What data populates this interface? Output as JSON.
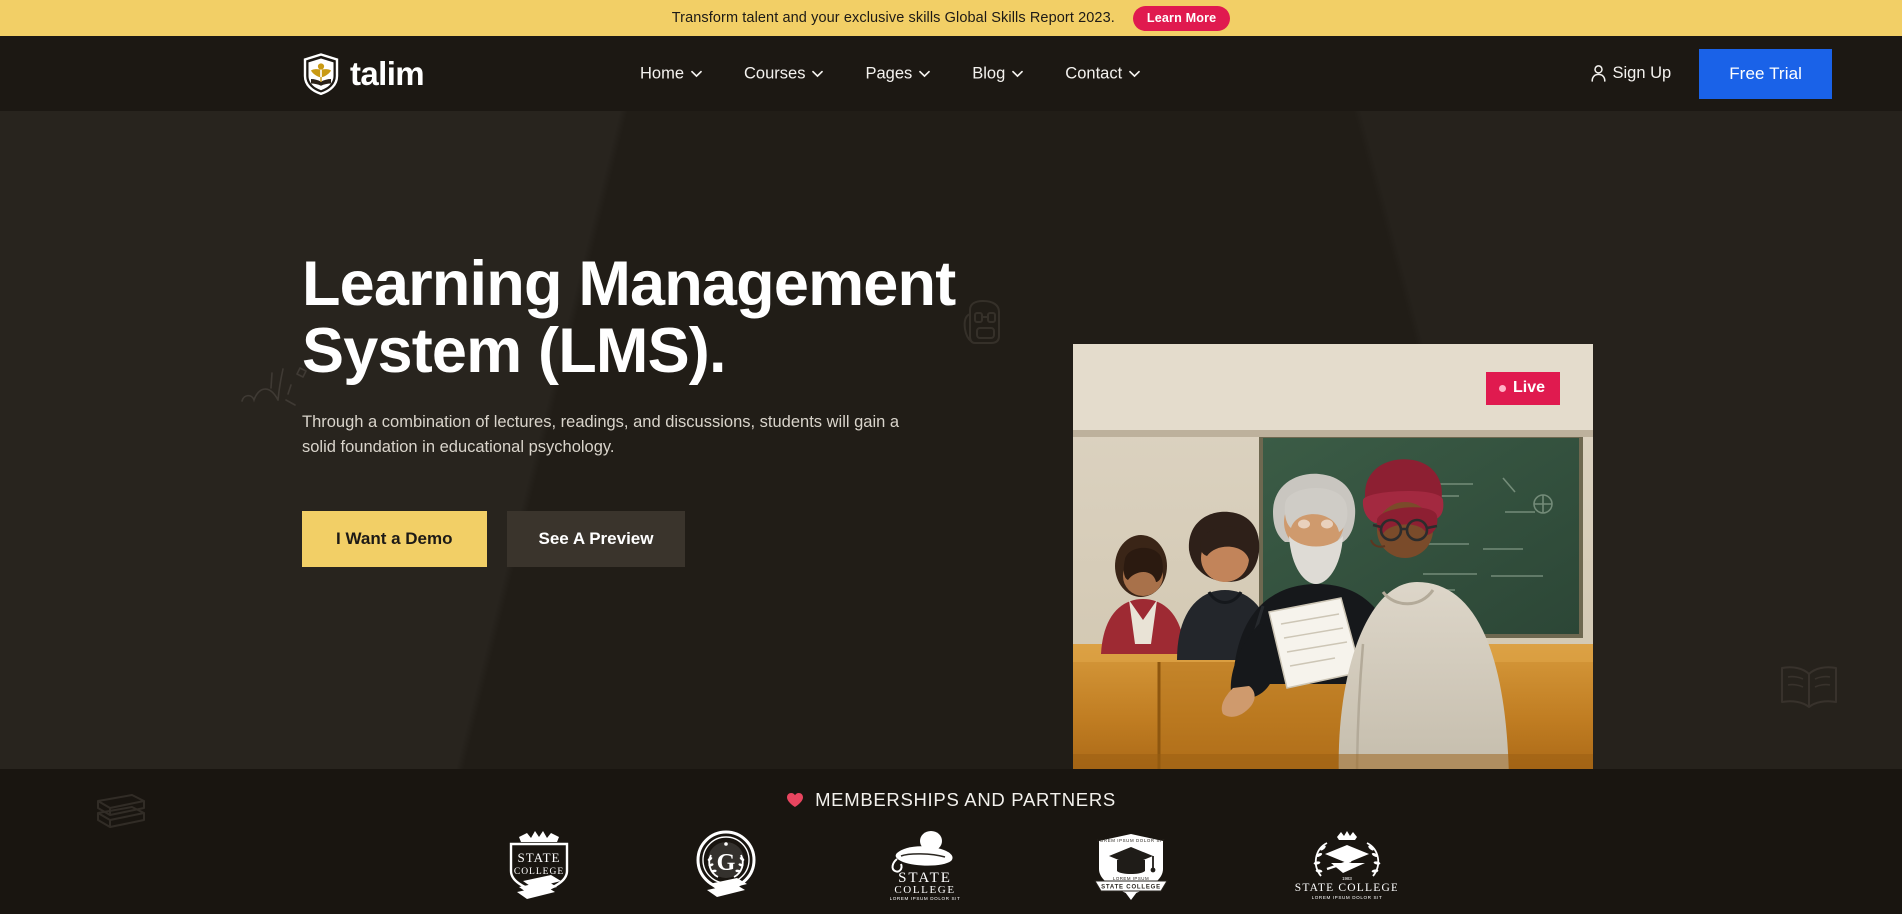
{
  "announcement": {
    "text": "Transform talent and your exclusive skills Global Skills Report 2023.",
    "button_label": "Learn More",
    "bg_color": "#f2cf66",
    "button_color": "#e01a4f"
  },
  "header": {
    "brand_name": "talim",
    "brand_icon": "shield-book-logo",
    "nav": [
      {
        "label": "Home",
        "icon": "chevron-down-icon"
      },
      {
        "label": "Courses",
        "icon": "chevron-down-icon"
      },
      {
        "label": "Pages",
        "icon": "chevron-down-icon"
      },
      {
        "label": "Blog",
        "icon": "chevron-down-icon"
      },
      {
        "label": "Contact",
        "icon": "chevron-down-icon"
      }
    ],
    "sign_up_label": "Sign Up",
    "sign_up_icon": "user-icon",
    "free_trial_label": "Free Trial",
    "free_trial_color": "#1a62e8",
    "bg_color": "#1c1813"
  },
  "hero": {
    "title": "Learning Management System (LMS).",
    "subtitle": "Through a combination of lectures, readings, and discussions, students will gain a solid foundation in educational psychology.",
    "primary_cta": "I Want a Demo",
    "secondary_cta": "See A Preview",
    "primary_cta_color": "#f2cf66",
    "secondary_cta_color": "#3a342c",
    "badge_label": "Live",
    "badge_icon": "live-dot-icon",
    "badge_color": "#e01a4f",
    "image_alt": "Professor reviewing papers with students in a classroom",
    "decorations": [
      "scribble-sparkle-icon",
      "backpack-outline-icon",
      "open-book-outline-icon",
      "stacked-books-outline-icon"
    ]
  },
  "partners": {
    "heading": "MEMBERSHIPS AND PARTNERS",
    "heading_icon": "heart-icon",
    "logos": [
      {
        "name": "state-college-crest",
        "line1": "STATE",
        "line2": "COLLEGE",
        "line3": ""
      },
      {
        "name": "g-seal-laurel",
        "line1": "G",
        "line2": "",
        "line3": ""
      },
      {
        "name": "state-college-cap-scroll",
        "line1": "STATE",
        "line2": "COLLEGE",
        "line3": "LOREM IPSUM DOLOR SIT"
      },
      {
        "name": "state-college-shield-cap",
        "line1": "LOREM IPSUM",
        "line2": "STATE COLLEGE",
        "line3": ""
      },
      {
        "name": "state-college-wreath",
        "line1": "STATE COLLEGE",
        "line2": "LOREM IPSUM DOLOR SIT",
        "line3": "1983"
      }
    ]
  }
}
